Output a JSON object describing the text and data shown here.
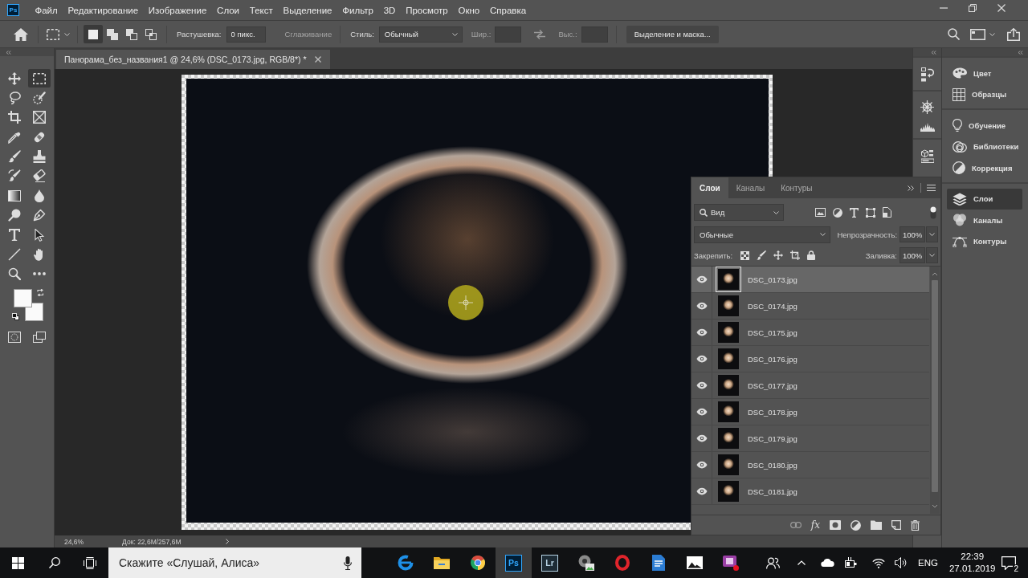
{
  "app": {
    "logo": "Ps"
  },
  "menu": [
    "Файл",
    "Редактирование",
    "Изображение",
    "Слои",
    "Текст",
    "Выделение",
    "Фильтр",
    "3D",
    "Просмотр",
    "Окно",
    "Справка"
  ],
  "options_bar": {
    "modes": [
      {
        "kind": "new",
        "selected": true
      },
      {
        "kind": "add",
        "selected": false
      },
      {
        "kind": "subtract",
        "selected": false
      },
      {
        "kind": "intersect",
        "selected": false
      }
    ],
    "feather": {
      "label": "Растушевка:",
      "value": "0 пикс."
    },
    "antialias": {
      "label": "Сглаживание",
      "disabled": true
    },
    "style": {
      "label": "Стиль:",
      "value": "Обычный"
    },
    "width": {
      "label": "Шир.:",
      "disabled": true
    },
    "height": {
      "label": "Выс.:",
      "disabled": true
    },
    "mask_button": "Выделение и маска..."
  },
  "toolbar": {
    "tools": [
      {
        "kind": "move",
        "selected": false
      },
      {
        "kind": "marquee",
        "selected": true
      },
      {
        "kind": "lasso",
        "selected": false
      },
      {
        "kind": "quickselect",
        "selected": false
      },
      {
        "kind": "crop",
        "selected": false
      },
      {
        "kind": "frame",
        "selected": false
      },
      {
        "kind": "eyedropper",
        "selected": false
      },
      {
        "kind": "healing",
        "selected": false
      },
      {
        "kind": "brush",
        "selected": false
      },
      {
        "kind": "stamp",
        "selected": false
      },
      {
        "kind": "historybrush",
        "selected": false
      },
      {
        "kind": "eraser",
        "selected": false
      },
      {
        "kind": "gradient",
        "selected": false
      },
      {
        "kind": "blur",
        "selected": false
      },
      {
        "kind": "dodge",
        "selected": false
      },
      {
        "kind": "pen",
        "selected": false
      },
      {
        "kind": "type",
        "selected": false
      },
      {
        "kind": "pathselect",
        "selected": false
      },
      {
        "kind": "line",
        "selected": false
      },
      {
        "kind": "hand",
        "selected": false
      },
      {
        "kind": "zoom",
        "selected": false
      },
      {
        "kind": "more",
        "selected": false
      }
    ]
  },
  "document": {
    "tab_title": "Панорама_без_названия1 @ 24,6% (DSC_0173.jpg, RGB/8*) *"
  },
  "status_bar": {
    "zoom": "24,6%",
    "doc_size": "Док: 22,6M/257,6M"
  },
  "layers_panel": {
    "tabs": [
      {
        "label": "Слои",
        "selected": true
      },
      {
        "label": "Каналы",
        "selected": false
      },
      {
        "label": "Контуры",
        "selected": false
      }
    ],
    "filter": "Вид",
    "blend_mode": "Обычные",
    "opacity": {
      "label": "Непрозрачность:",
      "value": "100%"
    },
    "lock_label": "Закрепить:",
    "fill": {
      "label": "Заливка:",
      "value": "100%"
    },
    "layers": [
      {
        "name": "DSC_0173.jpg",
        "visible": true,
        "selected": true
      },
      {
        "name": "DSC_0174.jpg",
        "visible": true,
        "selected": false
      },
      {
        "name": "DSC_0175.jpg",
        "visible": true,
        "selected": false
      },
      {
        "name": "DSC_0176.jpg",
        "visible": true,
        "selected": false
      },
      {
        "name": "DSC_0177.jpg",
        "visible": true,
        "selected": false
      },
      {
        "name": "DSC_0178.jpg",
        "visible": true,
        "selected": false
      },
      {
        "name": "DSC_0179.jpg",
        "visible": true,
        "selected": false
      },
      {
        "name": "DSC_0180.jpg",
        "visible": true,
        "selected": false
      },
      {
        "name": "DSC_0181.jpg",
        "visible": true,
        "selected": false
      }
    ],
    "effects_button": "fx"
  },
  "panel_dock": {
    "groups": [
      {
        "items": [
          {
            "kind": "color",
            "label": "Цвет",
            "selected": false
          },
          {
            "kind": "swatches",
            "label": "Образцы",
            "selected": false
          }
        ]
      },
      {
        "items": [
          {
            "kind": "learn",
            "label": "Обучение",
            "selected": false
          },
          {
            "kind": "libraries",
            "label": "Библиотеки",
            "selected": false
          },
          {
            "kind": "adjustments",
            "label": "Коррекция",
            "selected": false
          }
        ]
      },
      {
        "items": [
          {
            "kind": "layers",
            "label": "Слои",
            "selected": true
          },
          {
            "kind": "channels",
            "label": "Каналы",
            "selected": false
          },
          {
            "kind": "paths",
            "label": "Контуры",
            "selected": false
          }
        ]
      }
    ]
  },
  "taskbar": {
    "search_placeholder": "Скажите «Слушай, Алиса»",
    "apps": [
      {
        "kind": "edge",
        "selected": false
      },
      {
        "kind": "explorer",
        "selected": false
      },
      {
        "kind": "chrome",
        "selected": false
      },
      {
        "kind": "photoshop",
        "label": "Ps",
        "selected": true
      },
      {
        "kind": "lightroom",
        "label": "Lr",
        "selected": false
      },
      {
        "kind": "camera",
        "selected": false
      },
      {
        "kind": "opera",
        "selected": false
      },
      {
        "kind": "document",
        "selected": false
      },
      {
        "kind": "photos",
        "selected": false
      },
      {
        "kind": "video",
        "selected": false
      }
    ],
    "tray": {
      "language": "ENG",
      "time": "22:39",
      "date": "27.01.2019",
      "notification_count": "2"
    }
  }
}
